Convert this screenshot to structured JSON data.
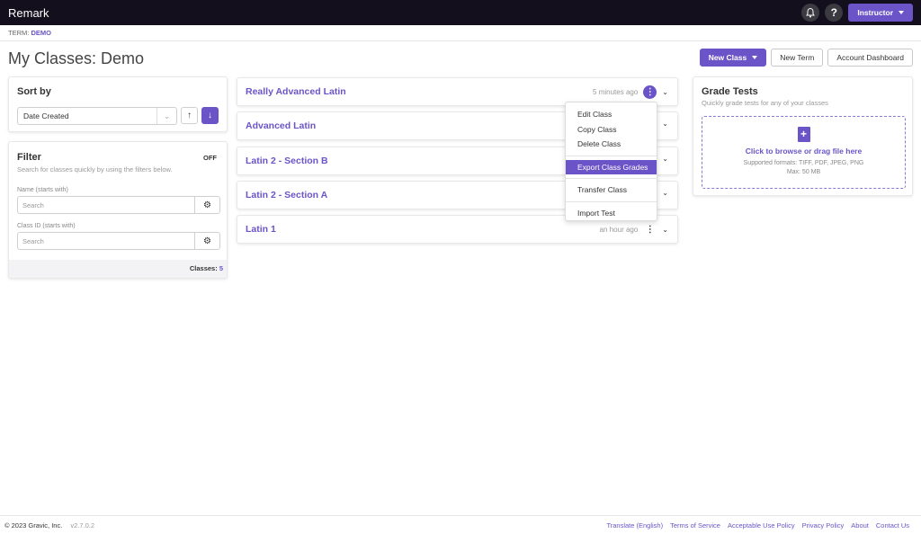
{
  "header": {
    "brand": "Remark",
    "bell_icon": "bell-icon",
    "help_icon": "question-icon",
    "help_glyph": "?",
    "user_menu_label": "Instructor"
  },
  "term": {
    "label": "TERM:",
    "value": "DEMO"
  },
  "page": {
    "title": "My Classes:",
    "term_name": "Demo"
  },
  "actions": {
    "new_class": "New Class",
    "new_term": "New Term",
    "account_dashboard": "Account Dashboard"
  },
  "sort": {
    "title": "Sort by",
    "selected": "Date Created",
    "asc_glyph": "↑",
    "desc_glyph": "↓"
  },
  "filter": {
    "title": "Filter",
    "state": "OFF",
    "description": "Search for classes quickly by using the filters below.",
    "name_label": "Name (starts with)",
    "name_placeholder": "Search",
    "classid_label": "Class ID (starts with)",
    "classid_placeholder": "Search",
    "count_label": "Classes:",
    "count_value": "5"
  },
  "classes": [
    {
      "name": "Really Advanced Latin",
      "time": "5 minutes ago"
    },
    {
      "name": "Advanced Latin",
      "time": ""
    },
    {
      "name": "Latin 2 - Section B",
      "time": ""
    },
    {
      "name": "Latin 2 - Section A",
      "time": ""
    },
    {
      "name": "Latin 1",
      "time": "an hour ago"
    }
  ],
  "menu": {
    "items": [
      "Edit Class",
      "Copy Class",
      "Delete Class",
      "Export Class Grades",
      "Transfer Class",
      "Import Test"
    ]
  },
  "grade": {
    "title": "Grade Tests",
    "subtitle": "Quickly grade tests for any of your classes",
    "drop_main": "Click to browse or drag file here",
    "formats": "Supported formats: TIFF, PDF, JPEG, PNG",
    "max": "Max: 50 MB"
  },
  "footer": {
    "copyright": "© 2023 Gravic, Inc.",
    "version": "v2.7.0.2",
    "links": [
      "Translate (English)",
      "Terms of Service",
      "Acceptable Use Policy",
      "Privacy Policy",
      "About",
      "Contact Us"
    ]
  },
  "colors": {
    "accent": "#6b54c8",
    "topbar": "#130f1c"
  }
}
